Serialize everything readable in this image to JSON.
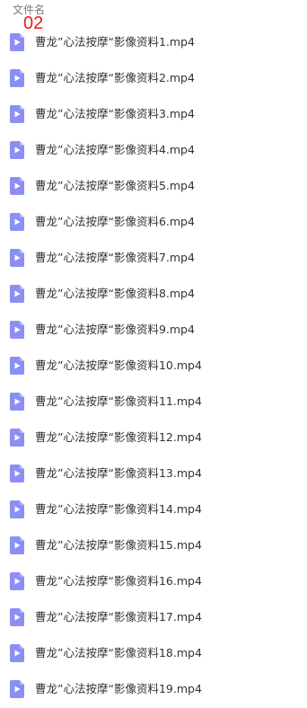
{
  "header": {
    "column_label": "文件名",
    "marker_text": "02"
  },
  "colors": {
    "icon_fill": "#8b8ff5",
    "marker": "#e81c1c"
  },
  "files": [
    {
      "name": "曹龙”心法按摩“影像资料1.mp4",
      "icon": "video-file-icon"
    },
    {
      "name": "曹龙”心法按摩“影像资料2.mp4",
      "icon": "video-file-icon"
    },
    {
      "name": "曹龙”心法按摩“影像资料3.mp4",
      "icon": "video-file-icon"
    },
    {
      "name": "曹龙”心法按摩“影像资料4.mp4",
      "icon": "video-file-icon"
    },
    {
      "name": "曹龙”心法按摩“影像资料5.mp4",
      "icon": "video-file-icon"
    },
    {
      "name": "曹龙”心法按摩“影像资料6.mp4",
      "icon": "video-file-icon"
    },
    {
      "name": "曹龙”心法按摩“影像资料7.mp4",
      "icon": "video-file-icon"
    },
    {
      "name": "曹龙”心法按摩“影像资料8.mp4",
      "icon": "video-file-icon"
    },
    {
      "name": "曹龙”心法按摩“影像资料9.mp4",
      "icon": "video-file-icon"
    },
    {
      "name": "曹龙”心法按摩“影像资料10.mp4",
      "icon": "video-file-icon"
    },
    {
      "name": "曹龙”心法按摩“影像资料11.mp4",
      "icon": "video-file-icon"
    },
    {
      "name": "曹龙”心法按摩“影像资料12.mp4",
      "icon": "video-file-icon"
    },
    {
      "name": "曹龙”心法按摩“影像资料13.mp4",
      "icon": "video-file-icon"
    },
    {
      "name": "曹龙”心法按摩“影像资料14.mp4",
      "icon": "video-file-icon"
    },
    {
      "name": "曹龙”心法按摩“影像资料15.mp4",
      "icon": "video-file-icon"
    },
    {
      "name": "曹龙”心法按摩“影像资料16.mp4",
      "icon": "video-file-icon"
    },
    {
      "name": "曹龙”心法按摩“影像资料17.mp4",
      "icon": "video-file-icon"
    },
    {
      "name": "曹龙”心法按摩“影像资料18.mp4",
      "icon": "video-file-icon"
    },
    {
      "name": "曹龙”心法按摩“影像资料19.mp4",
      "icon": "video-file-icon"
    }
  ]
}
